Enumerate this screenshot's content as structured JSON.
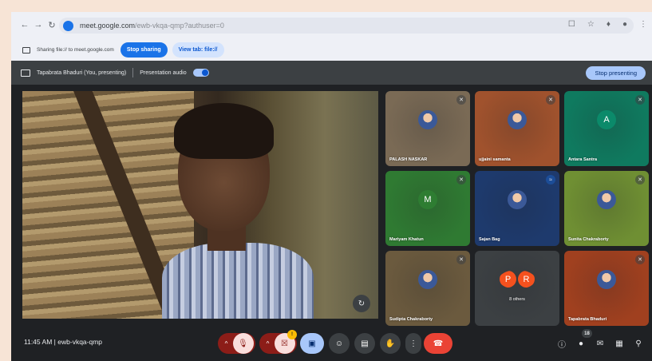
{
  "browser": {
    "url_host": "meet.google.com",
    "url_rest": "/ewb-vkqa-qmp?authuser=0",
    "back_icon": "arrow-left-icon",
    "forward_icon": "arrow-right-icon",
    "reload_icon": "reload-icon"
  },
  "sharing_bar": {
    "text": "Sharing file:// to meet.google.com",
    "stop_sharing_label": "Stop sharing",
    "view_tab_label": "View tab: file://"
  },
  "presenting_bar": {
    "presenter_text": "Tapabrata Bhaduri (You, presenting)",
    "audio_label": "Presentation audio",
    "audio_on": true,
    "stop_presenting_label": "Stop presenting"
  },
  "participants": [
    {
      "name": "PALASH NASKAR",
      "avatar": "photo",
      "muted": true,
      "bg": "#7a6a55"
    },
    {
      "name": "ujjaini samanta",
      "avatar": "photo",
      "muted": true,
      "bg": "#a0522d"
    },
    {
      "name": "Antara Santra",
      "avatar": "A",
      "muted": true,
      "bg": "#0f7a5f",
      "avatar_color": "#0b8a6a"
    },
    {
      "name": "Mariyam Khatun",
      "avatar": "M",
      "muted": true,
      "bg": "#2f7a32",
      "avatar_color": "#2e7d32"
    },
    {
      "name": "Sajan Bag",
      "avatar": "photo",
      "muted": false,
      "bg": "#1e3a6d"
    },
    {
      "name": "Sunita Chakraborty",
      "avatar": "photo",
      "muted": true,
      "bg": "#6f8f33"
    },
    {
      "name": "Sudipta Chakraborty",
      "avatar": "photo",
      "muted": true,
      "bg": "#6b5a3e"
    },
    {
      "name": "8 others",
      "avatar": "P R",
      "muted": false,
      "bg": "#3c4043",
      "avatar_color": "#f4511e"
    },
    {
      "name": "Tapabrata Bhaduri",
      "avatar": "photo",
      "muted": true,
      "bg": "#a0401f"
    }
  ],
  "toolbar": {
    "time": "11:45 AM",
    "separator": "|",
    "meeting_code": "ewb-vkqa-qmp",
    "camera_badge": "!",
    "participants_count": "18",
    "caret": "^"
  },
  "colors": {
    "accent": "#1a73e8",
    "danger": "#ea4335",
    "muted_red": "#8c1d18",
    "present_blue": "#a8c7fa"
  }
}
